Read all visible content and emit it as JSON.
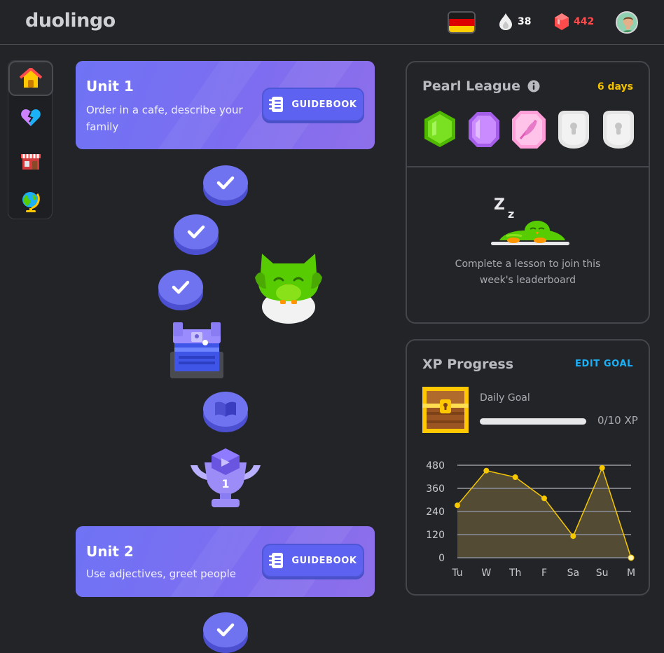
{
  "header": {
    "logo": "duolingo",
    "course_flag": "german-flag-icon",
    "streak": {
      "icon": "streak-drop-icon",
      "value": "38",
      "color": "#ffffff"
    },
    "gems": {
      "icon": "gem-icon",
      "value": "442",
      "color": "#ff4b4b"
    },
    "avatar": "user-avatar"
  },
  "sidebar": {
    "items": [
      {
        "name": "learn",
        "icon": "home-icon",
        "active": true
      },
      {
        "name": "hearts",
        "icon": "heart-icon",
        "active": false
      },
      {
        "name": "shop",
        "icon": "shop-icon",
        "active": false
      },
      {
        "name": "explore",
        "icon": "globe-icon",
        "active": false
      }
    ]
  },
  "units": [
    {
      "title": "Unit 1",
      "description": "Order in a cafe, describe your family",
      "guidebook_label": "GUIDEBOOK"
    },
    {
      "title": "Unit 2",
      "description": "Use adjectives, greet people",
      "guidebook_label": "GUIDEBOOK"
    }
  ],
  "path": {
    "nodes": [
      "completed-lesson",
      "completed-lesson",
      "completed-lesson",
      "treasure-chest",
      "story",
      "unit-trophy",
      "completed-lesson"
    ],
    "trophy_number": "1"
  },
  "league": {
    "title": "Pearl League",
    "days_left": "6 days",
    "message": "Complete a lesson to join this week's leaderboard",
    "badges": [
      "emerald-league-icon",
      "amethyst-league-icon",
      "pearl-league-icon",
      "locked-league-icon",
      "locked-league-icon"
    ]
  },
  "xp": {
    "title": "XP Progress",
    "edit_goal": "EDIT GOAL",
    "daily_goal_label": "Daily Goal",
    "progress_text": "0/10 XP",
    "progress_fraction": 0,
    "accent": "#f7c800"
  },
  "chart_data": {
    "type": "area",
    "categories": [
      "Tu",
      "W",
      "Th",
      "F",
      "Sa",
      "Su",
      "M"
    ],
    "values": [
      272,
      452,
      418,
      308,
      112,
      466,
      0
    ],
    "yticks": [
      0,
      120,
      240,
      360,
      480
    ],
    "ylim": [
      0,
      480
    ],
    "grid": true,
    "title": "",
    "xlabel": "",
    "ylabel": ""
  }
}
